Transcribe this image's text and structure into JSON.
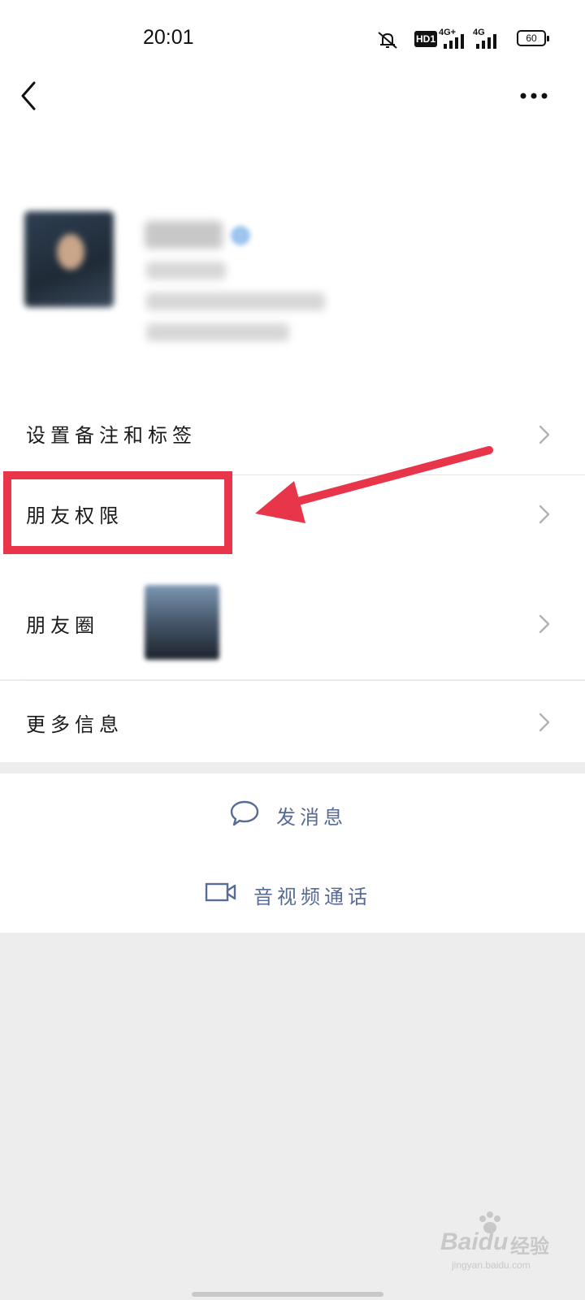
{
  "status_bar": {
    "time": "20:01",
    "hd_badge": "HD1",
    "net_1": "4G+",
    "net_2": "4G",
    "battery": "60"
  },
  "nav": {
    "back_icon": "chevron-left-icon",
    "more_icon": "more-dots-icon"
  },
  "menu": {
    "set_remark_tags": "设置备注和标签",
    "friend_permissions": "朋友权限",
    "moments": "朋友圈",
    "more_info": "更多信息"
  },
  "actions": {
    "send_message": "发消息",
    "video_call": "音视频通话"
  },
  "watermark": {
    "brand": "Baidu",
    "cn": "经验",
    "sub": "jingyan.baidu.com"
  },
  "colors": {
    "highlight": "#e8354a",
    "link_blue": "#576b95",
    "background": "#ededed"
  }
}
